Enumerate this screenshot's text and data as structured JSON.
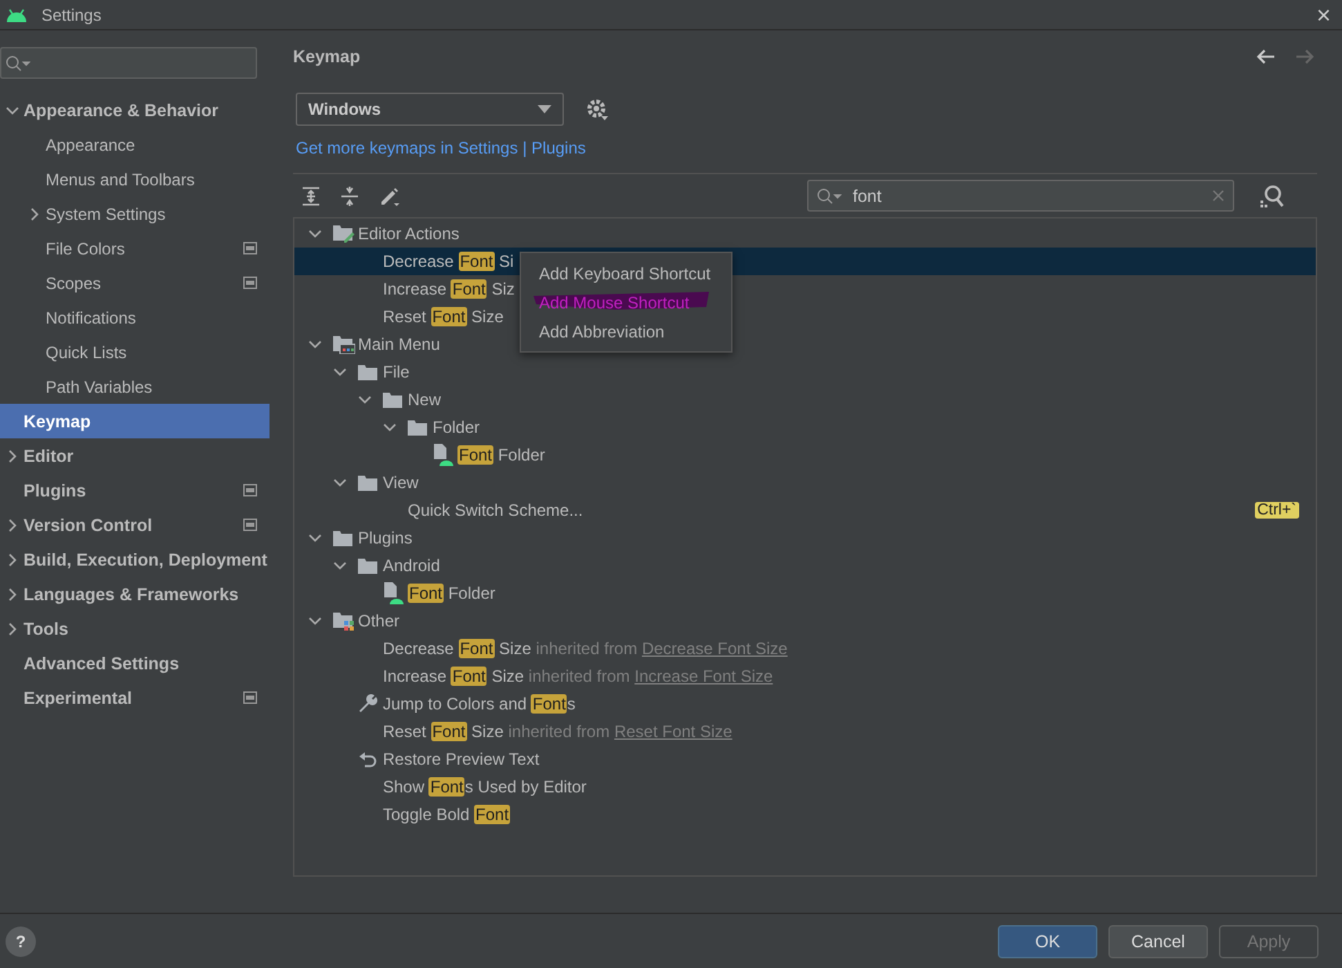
{
  "window": {
    "title": "Settings",
    "close": "×"
  },
  "sidebar": {
    "items": [
      {
        "label": "Appearance & Behavior",
        "expanded": true,
        "selected": false,
        "badge": false,
        "children": [
          {
            "label": "Appearance",
            "selected": false,
            "badge": false
          },
          {
            "label": "Menus and Toolbars",
            "selected": false,
            "badge": false
          },
          {
            "label": "System Settings",
            "expanded": false,
            "selected": false,
            "badge": false
          },
          {
            "label": "File Colors",
            "selected": false,
            "badge": true
          },
          {
            "label": "Scopes",
            "selected": false,
            "badge": true
          },
          {
            "label": "Notifications",
            "selected": false,
            "badge": false
          },
          {
            "label": "Quick Lists",
            "selected": false,
            "badge": false
          },
          {
            "label": "Path Variables",
            "selected": false,
            "badge": false
          }
        ]
      },
      {
        "label": "Keymap",
        "selected": true,
        "badge": false
      },
      {
        "label": "Editor",
        "expanded": false,
        "selected": false,
        "badge": false
      },
      {
        "label": "Plugins",
        "selected": false,
        "badge": true
      },
      {
        "label": "Version Control",
        "expanded": false,
        "selected": false,
        "badge": true
      },
      {
        "label": "Build, Execution, Deployment",
        "expanded": false,
        "selected": false,
        "badge": false
      },
      {
        "label": "Languages & Frameworks",
        "expanded": false,
        "selected": false,
        "badge": false
      },
      {
        "label": "Tools",
        "expanded": false,
        "selected": false,
        "badge": false
      },
      {
        "label": "Advanced Settings",
        "selected": false,
        "badge": false
      },
      {
        "label": "Experimental",
        "selected": false,
        "badge": true
      }
    ]
  },
  "keymap": {
    "title": "Keymap",
    "scheme": "Windows",
    "link": "Get more keymaps in Settings | Plugins",
    "search": {
      "value": "font"
    },
    "tree": [
      {
        "kind": "editor-group",
        "expanded": true,
        "selected": false,
        "parts": [
          {
            "kind": "plain",
            "text": "Editor Actions"
          }
        ],
        "children": [
          {
            "kind": "action",
            "selected": true,
            "parts": [
              {
                "kind": "plain",
                "text": "Decrease "
              },
              {
                "kind": "match",
                "text": "Font"
              },
              {
                "kind": "plain",
                "text": " Si"
              }
            ]
          },
          {
            "kind": "action",
            "selected": false,
            "parts": [
              {
                "kind": "plain",
                "text": "Increase "
              },
              {
                "kind": "match",
                "text": "Font"
              },
              {
                "kind": "plain",
                "text": " Siz"
              }
            ]
          },
          {
            "kind": "action",
            "selected": false,
            "parts": [
              {
                "kind": "plain",
                "text": "Reset "
              },
              {
                "kind": "match",
                "text": "Font"
              },
              {
                "kind": "plain",
                "text": " Size"
              }
            ]
          }
        ]
      },
      {
        "kind": "menu-group",
        "expanded": true,
        "selected": false,
        "parts": [
          {
            "kind": "plain",
            "text": "Main Menu"
          }
        ],
        "children": [
          {
            "kind": "group",
            "expanded": true,
            "selected": false,
            "parts": [
              {
                "kind": "plain",
                "text": "File"
              }
            ],
            "children": [
              {
                "kind": "group",
                "expanded": true,
                "selected": false,
                "parts": [
                  {
                    "kind": "plain",
                    "text": "New"
                  }
                ],
                "children": [
                  {
                    "kind": "group",
                    "expanded": true,
                    "selected": false,
                    "parts": [
                      {
                        "kind": "plain",
                        "text": "Folder"
                      }
                    ],
                    "children": [
                      {
                        "kind": "android",
                        "selected": false,
                        "parts": [
                          {
                            "kind": "match",
                            "text": "Font"
                          },
                          {
                            "kind": "plain",
                            "text": " Folder"
                          }
                        ]
                      }
                    ]
                  }
                ]
              }
            ]
          },
          {
            "kind": "group",
            "expanded": true,
            "selected": false,
            "parts": [
              {
                "kind": "plain",
                "text": "View"
              }
            ],
            "children": [
              {
                "kind": "action",
                "selected": false,
                "parts": [
                  {
                    "kind": "plain",
                    "text": "Quick Switch Scheme..."
                  }
                ],
                "shortcut": "Ctrl+`"
              }
            ]
          }
        ]
      },
      {
        "kind": "group",
        "expanded": true,
        "selected": false,
        "parts": [
          {
            "kind": "plain",
            "text": "Plugins"
          }
        ],
        "children": [
          {
            "kind": "group",
            "expanded": true,
            "selected": false,
            "parts": [
              {
                "kind": "plain",
                "text": "Android"
              }
            ],
            "children": [
              {
                "kind": "android",
                "selected": false,
                "parts": [
                  {
                    "kind": "match",
                    "text": "Font"
                  },
                  {
                    "kind": "plain",
                    "text": " Folder"
                  }
                ]
              }
            ]
          }
        ]
      },
      {
        "kind": "other-group",
        "expanded": true,
        "selected": false,
        "parts": [
          {
            "kind": "plain",
            "text": "Other"
          }
        ],
        "children": [
          {
            "kind": "action",
            "selected": false,
            "parts": [
              {
                "kind": "plain",
                "text": "Decrease "
              },
              {
                "kind": "match",
                "text": "Font"
              },
              {
                "kind": "plain",
                "text": " Size"
              },
              {
                "kind": "note",
                "text": " inherited from "
              },
              {
                "kind": "link",
                "text": "Decrease Font Size"
              }
            ]
          },
          {
            "kind": "action",
            "selected": false,
            "parts": [
              {
                "kind": "plain",
                "text": "Increase "
              },
              {
                "kind": "match",
                "text": "Font"
              },
              {
                "kind": "plain",
                "text": " Size"
              },
              {
                "kind": "note",
                "text": " inherited from "
              },
              {
                "kind": "link",
                "text": "Increase Font Size"
              }
            ]
          },
          {
            "kind": "tool",
            "selected": false,
            "parts": [
              {
                "kind": "plain",
                "text": "Jump to Colors and "
              },
              {
                "kind": "match",
                "text": "Font"
              },
              {
                "kind": "plain",
                "text": "s"
              }
            ]
          },
          {
            "kind": "action",
            "selected": false,
            "parts": [
              {
                "kind": "plain",
                "text": "Reset "
              },
              {
                "kind": "match",
                "text": "Font"
              },
              {
                "kind": "plain",
                "text": " Size"
              },
              {
                "kind": "note",
                "text": " inherited from "
              },
              {
                "kind": "link",
                "text": "Reset Font Size"
              }
            ]
          },
          {
            "kind": "restore",
            "selected": false,
            "parts": [
              {
                "kind": "plain",
                "text": "Restore Preview Text"
              }
            ]
          },
          {
            "kind": "action",
            "selected": false,
            "parts": [
              {
                "kind": "plain",
                "text": "Show "
              },
              {
                "kind": "match",
                "text": "Font"
              },
              {
                "kind": "plain",
                "text": "s Used by Editor"
              }
            ]
          },
          {
            "kind": "action",
            "selected": false,
            "parts": [
              {
                "kind": "plain",
                "text": "Toggle Bold "
              },
              {
                "kind": "match",
                "text": "Font"
              }
            ]
          }
        ]
      }
    ],
    "popup": [
      {
        "label": "Add Keyboard Shortcut",
        "marked": false
      },
      {
        "label": "Add Mouse Shortcut",
        "marked": true
      },
      {
        "label": "Add Abbreviation",
        "marked": false
      }
    ]
  },
  "buttons": [
    {
      "label": "OK",
      "kind": "primary",
      "disabled": false
    },
    {
      "label": "Cancel",
      "kind": "normal",
      "disabled": false
    },
    {
      "label": "Apply",
      "kind": "normal",
      "disabled": true
    }
  ],
  "help": "?"
}
